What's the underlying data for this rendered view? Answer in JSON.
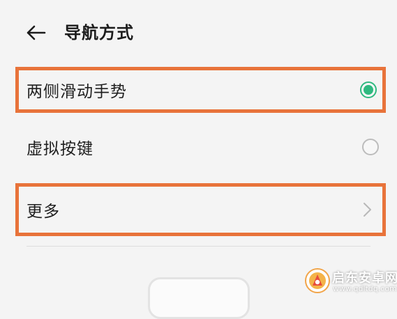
{
  "header": {
    "title": "导航方式",
    "back_icon": "arrow-left-icon"
  },
  "options": [
    {
      "label": "两侧滑动手势",
      "control": "radio",
      "selected": true,
      "highlighted": true
    },
    {
      "label": "虚拟按键",
      "control": "radio",
      "selected": false,
      "highlighted": false
    },
    {
      "label": "更多",
      "control": "chevron-right-icon",
      "highlighted": true
    }
  ],
  "watermark": {
    "name": "启东安卓网",
    "url": "www.qdltdq.com"
  },
  "colors": {
    "background": "#f4f4f4",
    "highlight_border": "#e8733a",
    "radio_selected": "#2fb980",
    "radio_unselected": "#bcbcbc",
    "text": "#222222",
    "divider": "#dcdcdc"
  }
}
